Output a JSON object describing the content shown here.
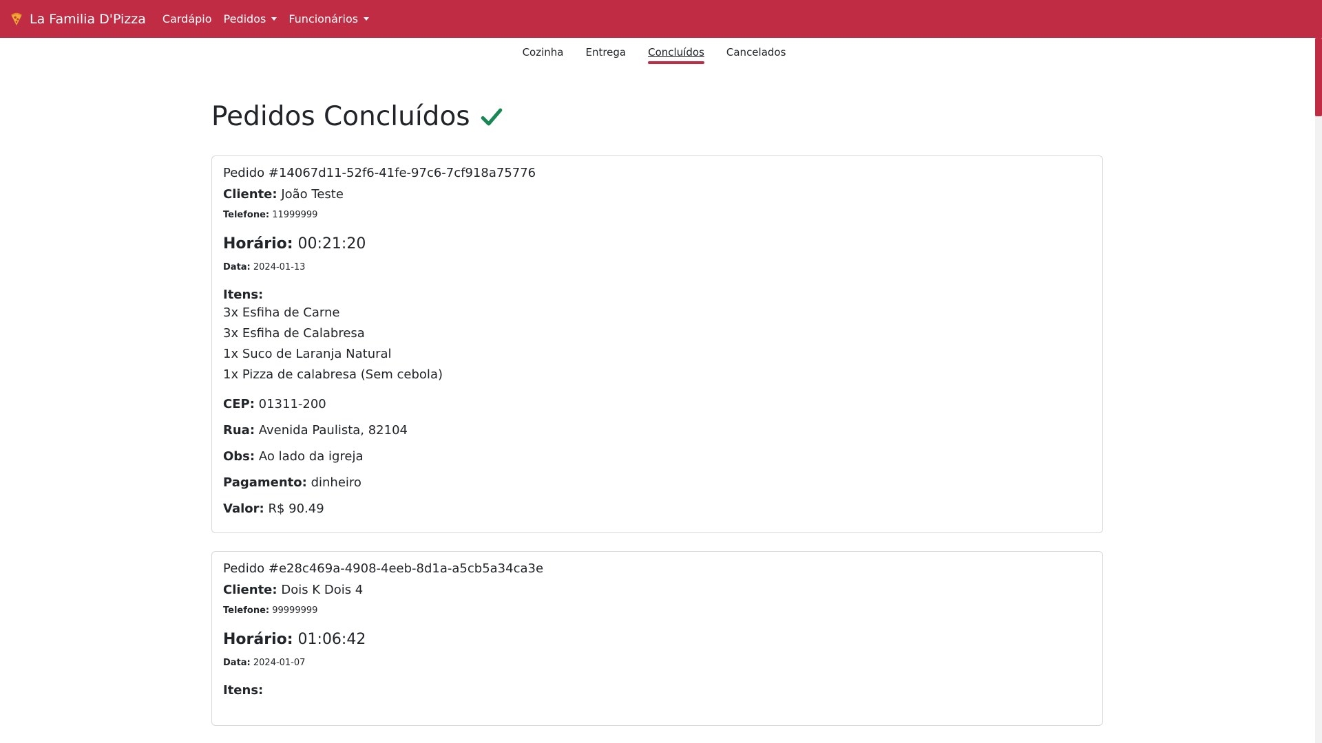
{
  "navbar": {
    "brand": "La Familia D'Pizza",
    "links": [
      {
        "label": "Cardápio",
        "dropdown": false
      },
      {
        "label": "Pedidos",
        "dropdown": true
      },
      {
        "label": "Funcionários",
        "dropdown": true
      }
    ],
    "accent_color": "#bf2c44"
  },
  "tabs": [
    {
      "label": "Cozinha",
      "active": false
    },
    {
      "label": "Entrega",
      "active": false
    },
    {
      "label": "Concluídos",
      "active": true
    },
    {
      "label": "Cancelados",
      "active": false
    }
  ],
  "page_title": "Pedidos Concluídos",
  "title_icon": "check-icon",
  "orders": [
    {
      "title": "Pedido #14067d11-52f6-41fe-97c6-7cf918a75776",
      "cliente_label": "Cliente:",
      "cliente": "João Teste",
      "telefone_label": "Telefone:",
      "telefone": "11999999",
      "horario_label": "Horário:",
      "horario": "00:21:20",
      "data_label": "Data:",
      "data": "2024-01-13",
      "itens_label": "Itens:",
      "itens": [
        "3x Esfiha de Carne",
        "3x Esfiha de Calabresa",
        "1x Suco de Laranja Natural",
        "1x Pizza de calabresa (Sem cebola)"
      ],
      "cep_label": "CEP:",
      "cep": "01311-200",
      "rua_label": "Rua:",
      "rua": "Avenida Paulista, 82104",
      "obs_label": "Obs:",
      "obs": "Ao lado da igreja",
      "pagamento_label": "Pagamento:",
      "pagamento": "dinheiro",
      "valor_label": "Valor:",
      "valor": "R$ 90.49"
    },
    {
      "title": "Pedido #e28c469a-4908-4eeb-8d1a-a5cb5a34ca3e",
      "cliente_label": "Cliente:",
      "cliente": "Dois K Dois 4",
      "telefone_label": "Telefone:",
      "telefone": "99999999",
      "horario_label": "Horário:",
      "horario": "01:06:42",
      "data_label": "Data:",
      "data": "2024-01-07",
      "itens_label": "Itens:"
    }
  ]
}
